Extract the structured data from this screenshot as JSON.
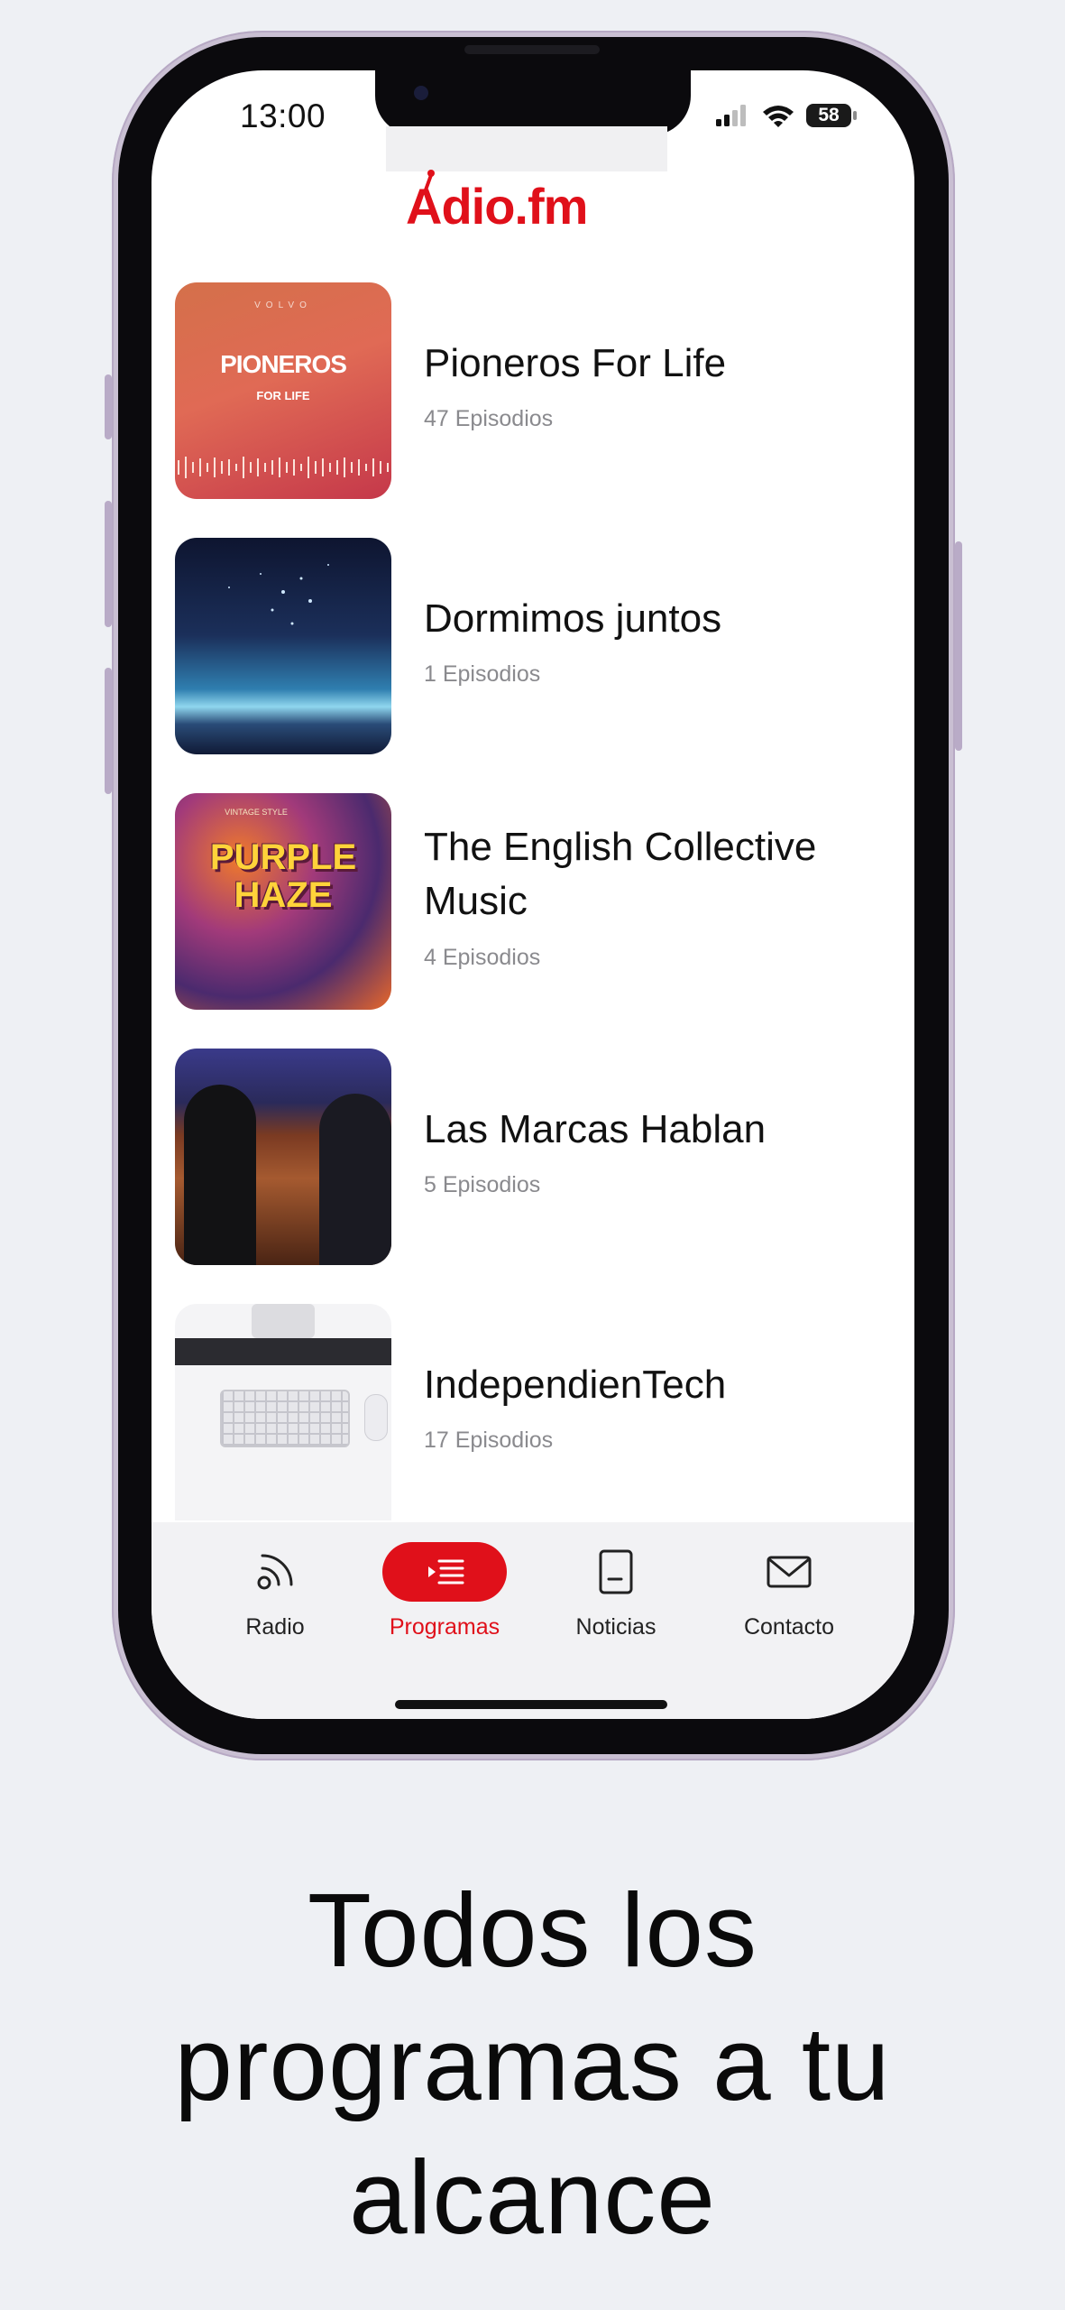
{
  "status_bar": {
    "time": "13:00",
    "battery": "58"
  },
  "app": {
    "logo_text": "Adio.fm"
  },
  "programs": [
    {
      "title": "Pioneros For Life",
      "episodes": "47 Episodios",
      "cover_text": "PIONEROS",
      "cover_sub": "FOR LIFE",
      "cover_brand": "VOLVO"
    },
    {
      "title": "Dormimos juntos",
      "episodes": "1 Episodios"
    },
    {
      "title": "The English Collective Music",
      "episodes": "4 Episodios",
      "cover_text": "PURPLE HAZE",
      "cover_sub": "VINTAGE STYLE"
    },
    {
      "title": "Las Marcas Hablan",
      "episodes": "5 Episodios"
    },
    {
      "title": "IndependienTech",
      "episodes": "17 Episodios"
    }
  ],
  "tabbar": {
    "tabs": [
      {
        "label": "Radio",
        "icon": "radio-waves-icon"
      },
      {
        "label": "Programas",
        "icon": "list-play-icon",
        "active": true
      },
      {
        "label": "Noticias",
        "icon": "document-icon"
      },
      {
        "label": "Contacto",
        "icon": "mail-icon"
      }
    ]
  },
  "headline": "Todos los programas a tu alcance",
  "colors": {
    "accent": "#e0101a",
    "background": "#eef0f4"
  }
}
